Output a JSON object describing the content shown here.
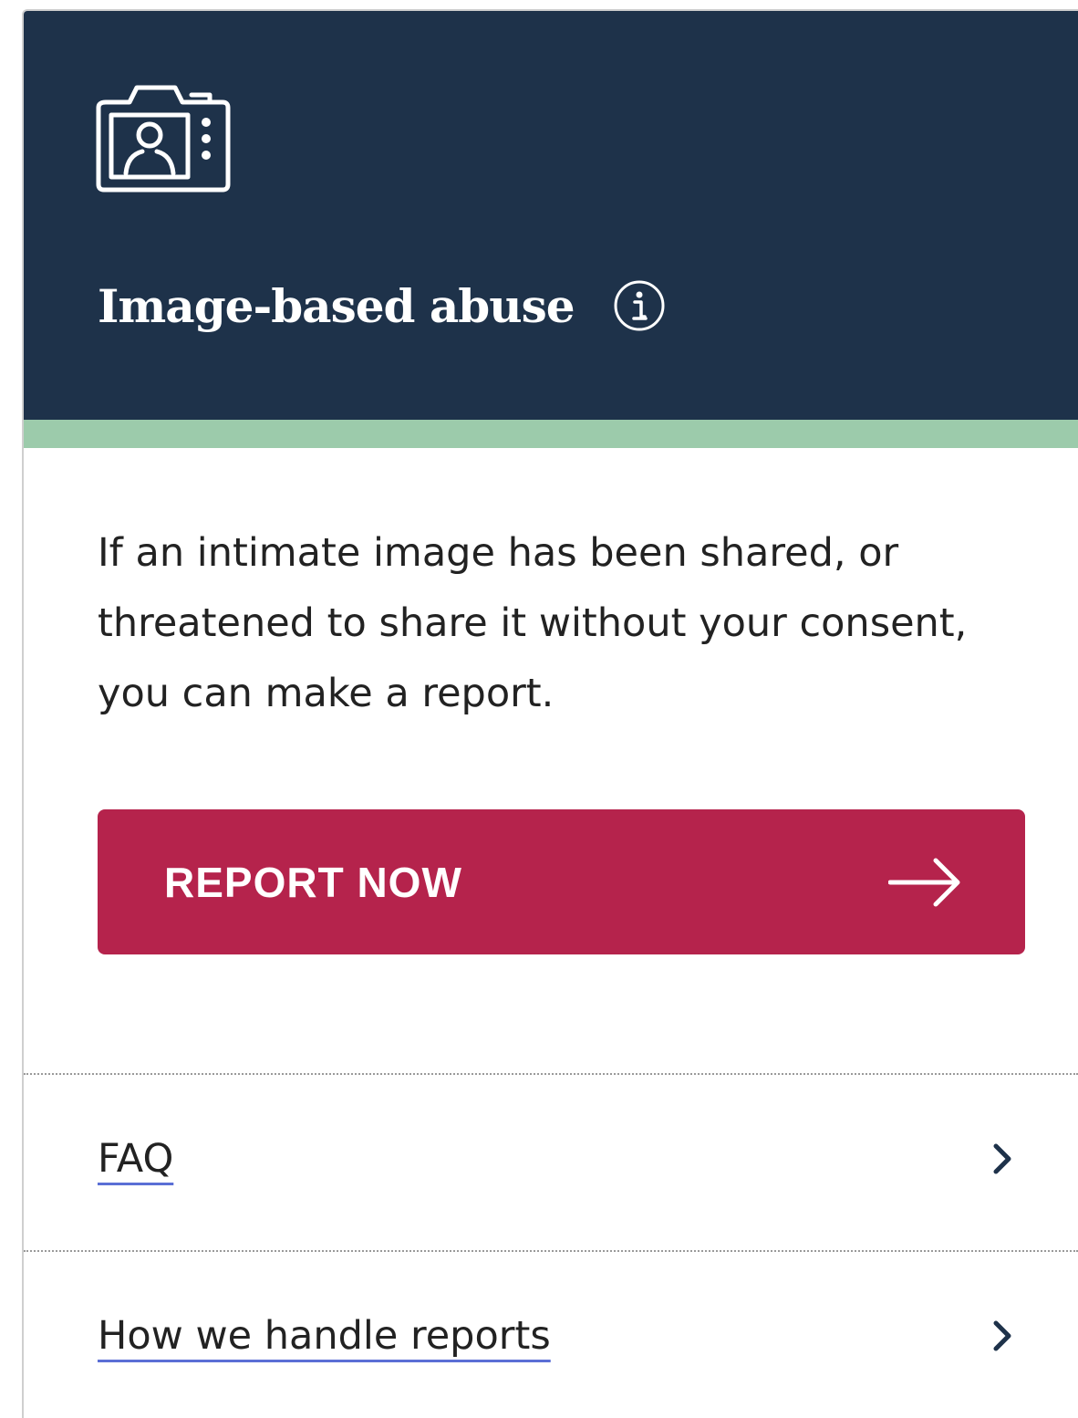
{
  "header": {
    "icon": "camera-portrait-icon",
    "title": "Image-based abuse",
    "info_icon": "info-icon"
  },
  "colors": {
    "header_bg": "#1e324a",
    "accent_bar": "#9ccbab",
    "button_bg": "#b5234c",
    "link_underline": "#5b6fd6"
  },
  "description": "If an intimate image has been shared, or threatened to share it without your consent, you can make a report.",
  "report_button": {
    "label": "REPORT NOW",
    "icon": "arrow-right-icon"
  },
  "links": [
    {
      "label": "FAQ",
      "icon": "chevron-right-icon"
    },
    {
      "label": "How we handle reports",
      "icon": "chevron-right-icon"
    }
  ]
}
